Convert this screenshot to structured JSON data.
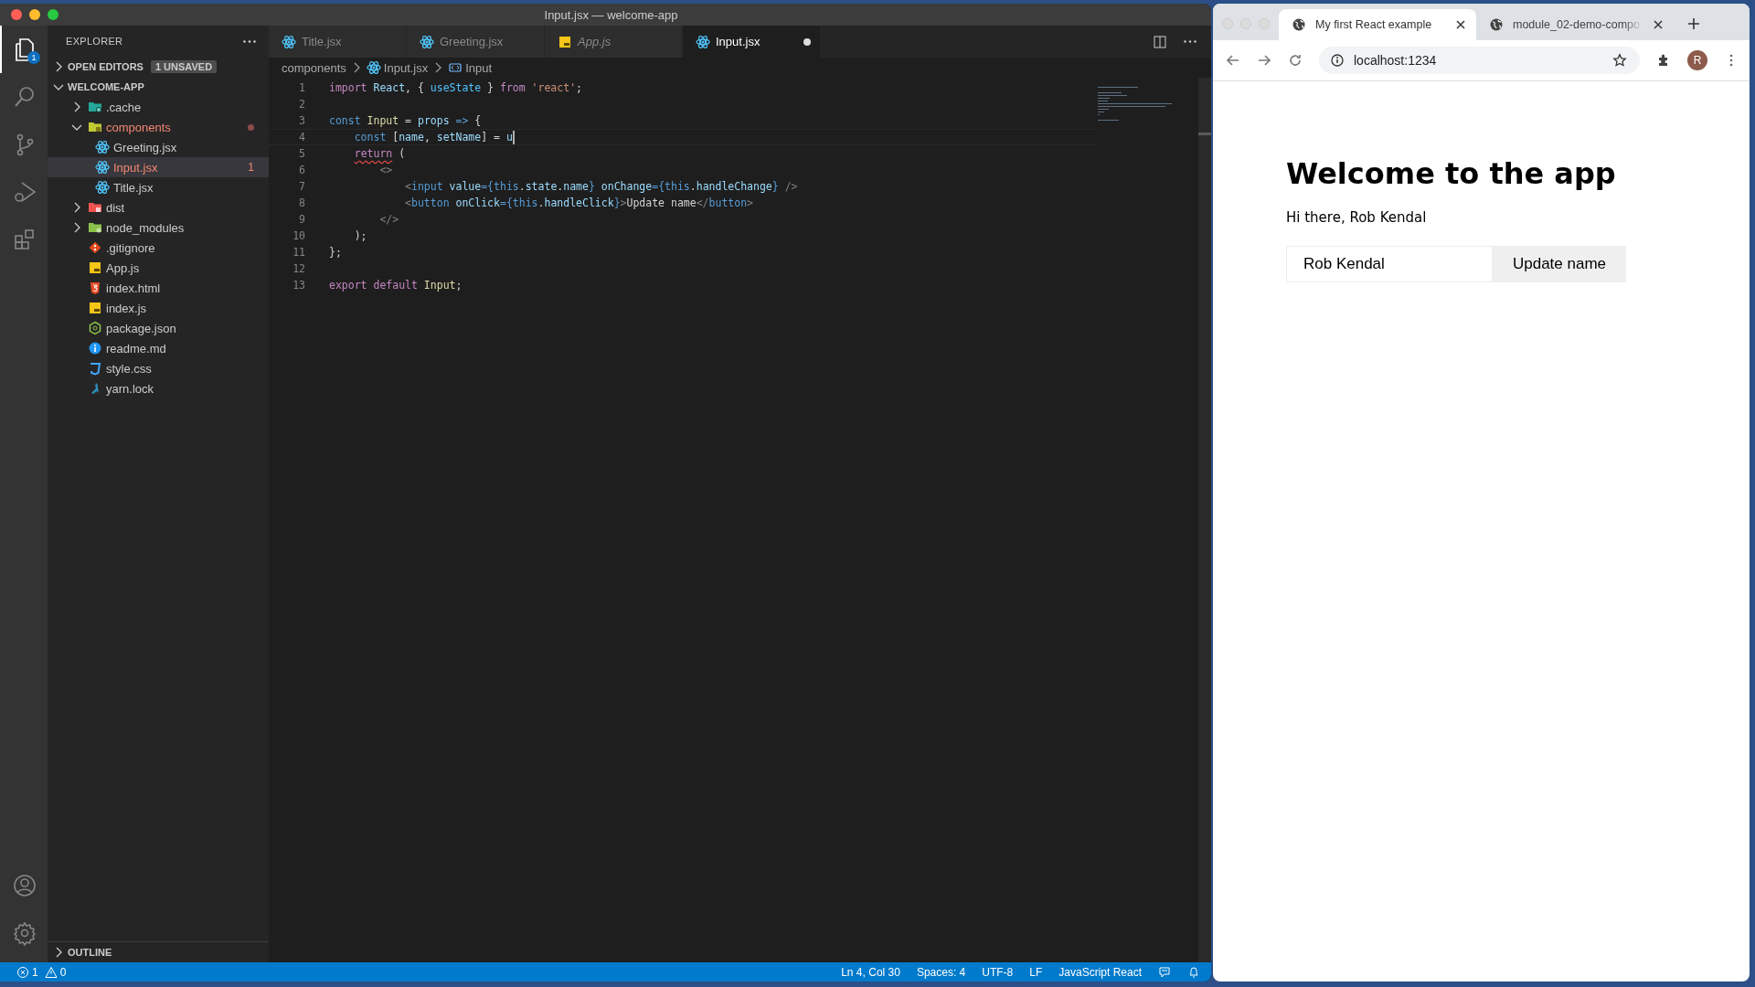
{
  "editor_window": {
    "title": "Input.jsx — welcome-app",
    "activity_bar": [
      {
        "kind": "files",
        "selected": true,
        "badge": "1"
      },
      {
        "kind": "search",
        "selected": false
      },
      {
        "kind": "source-control",
        "selected": false
      },
      {
        "kind": "run",
        "selected": false
      },
      {
        "kind": "extensions",
        "selected": false
      }
    ],
    "activity_bar_bottom": [
      {
        "kind": "account"
      },
      {
        "kind": "settings"
      }
    ],
    "sidebar": {
      "title": "EXPLORER",
      "open_editors": {
        "label": "OPEN EDITORS",
        "badge": "1 UNSAVED",
        "expanded": false
      },
      "project": {
        "label": "WELCOME-APP",
        "expanded": true
      },
      "tree": [
        {
          "label": ".cache",
          "kind": "cache-folder",
          "expanded": false,
          "selected": false,
          "error": false
        },
        {
          "label": "components",
          "kind": "components-folder",
          "expanded": true,
          "selected": false,
          "error": true,
          "children": [
            {
              "label": "Greeting.jsx",
              "kind": "react-file",
              "selected": false,
              "error": false
            },
            {
              "label": "Input.jsx",
              "kind": "react-file",
              "selected": true,
              "error": true,
              "problems": "1"
            },
            {
              "label": "Title.jsx",
              "kind": "react-file",
              "selected": false,
              "error": false
            }
          ]
        },
        {
          "label": "dist",
          "kind": "dist-folder",
          "expanded": false,
          "selected": false,
          "error": false
        },
        {
          "label": "node_modules",
          "kind": "node-folder",
          "expanded": false,
          "selected": false,
          "error": false
        },
        {
          "label": ".gitignore",
          "kind": "git-file",
          "selected": false,
          "error": false
        },
        {
          "label": "App.js",
          "kind": "js-file",
          "selected": false,
          "error": false
        },
        {
          "label": "index.html",
          "kind": "html-file",
          "selected": false,
          "error": false
        },
        {
          "label": "index.js",
          "kind": "js-file",
          "selected": false,
          "error": false
        },
        {
          "label": "package.json",
          "kind": "json-file",
          "selected": false,
          "error": false
        },
        {
          "label": "readme.md",
          "kind": "md-file",
          "selected": false,
          "error": false
        },
        {
          "label": "style.css",
          "kind": "css-file",
          "selected": false,
          "error": false
        },
        {
          "label": "yarn.lock",
          "kind": "yarn-file",
          "selected": false,
          "error": false
        }
      ],
      "outline": {
        "label": "OUTLINE",
        "expanded": false
      }
    },
    "tabs": [
      {
        "label": "Title.jsx",
        "kind": "react-file",
        "selected": false,
        "preview": false,
        "dirty": false
      },
      {
        "label": "Greeting.jsx",
        "kind": "react-file",
        "selected": false,
        "preview": false,
        "dirty": false
      },
      {
        "label": "App.js",
        "kind": "js-file",
        "selected": false,
        "preview": true,
        "dirty": false
      },
      {
        "label": "Input.jsx",
        "kind": "react-file",
        "selected": true,
        "preview": false,
        "dirty": true
      }
    ],
    "breadcrumb": [
      {
        "label": "components",
        "kind": "folder"
      },
      {
        "label": "Input.jsx",
        "kind": "react-file"
      },
      {
        "label": "Input",
        "kind": "symbol"
      }
    ],
    "code": [
      {
        "number": "1",
        "cursor": false,
        "tokens": [
          {
            "text": "import ",
            "kind": "kw"
          },
          {
            "text": "React",
            "kind": "var"
          },
          {
            "text": ", { ",
            "kind": "p"
          },
          {
            "text": "useState",
            "kind": "fn"
          },
          {
            "text": " } ",
            "kind": "p"
          },
          {
            "text": "from ",
            "kind": "kw"
          },
          {
            "text": "'react'",
            "kind": "str"
          },
          {
            "text": ";",
            "kind": "p"
          }
        ]
      },
      {
        "number": "2",
        "cursor": false
      },
      {
        "number": "3",
        "cursor": false,
        "tokens": [
          {
            "text": "const ",
            "kind": "st"
          },
          {
            "text": "Input",
            "kind": "cls"
          },
          {
            "text": " = ",
            "kind": "p"
          },
          {
            "text": "props",
            "kind": "var"
          },
          {
            "text": " => ",
            "kind": "st"
          },
          {
            "text": "{",
            "kind": "p"
          }
        ]
      },
      {
        "number": "4",
        "cursor": true,
        "tokens": [
          {
            "text": "    const ",
            "kind": "st"
          },
          {
            "text": "[",
            "kind": "p"
          },
          {
            "text": "name",
            "kind": "var"
          },
          {
            "text": ", ",
            "kind": "p"
          },
          {
            "text": "setName",
            "kind": "var"
          },
          {
            "text": "] = ",
            "kind": "p"
          },
          {
            "text": "u",
            "kind": "var"
          }
        ]
      },
      {
        "number": "5",
        "cursor": false,
        "tokens": [
          {
            "text": "    return",
            "kind": "flagged"
          },
          {
            "text": " (",
            "kind": "p"
          }
        ]
      },
      {
        "number": "6",
        "cursor": false,
        "tokens": [
          {
            "text": "        <>",
            "kind": "tag"
          }
        ]
      },
      {
        "number": "7",
        "cursor": false,
        "tokens": [
          {
            "text": "            <",
            "kind": "tag"
          },
          {
            "text": "input ",
            "kind": "st"
          },
          {
            "text": "value",
            "kind": "var"
          },
          {
            "text": "={",
            "kind": "st"
          },
          {
            "text": "this",
            "kind": "st"
          },
          {
            "text": ".",
            "kind": "p"
          },
          {
            "text": "state",
            "kind": "var"
          },
          {
            "text": ".",
            "kind": "p"
          },
          {
            "text": "name",
            "kind": "var"
          },
          {
            "text": "}",
            "kind": "st"
          },
          {
            "text": " onChange",
            "kind": "var"
          },
          {
            "text": "={",
            "kind": "st"
          },
          {
            "text": "this",
            "kind": "st"
          },
          {
            "text": ".",
            "kind": "p"
          },
          {
            "text": "handleChange",
            "kind": "var"
          },
          {
            "text": "}",
            "kind": "st"
          },
          {
            "text": " />",
            "kind": "tag"
          }
        ]
      },
      {
        "number": "8",
        "cursor": false,
        "tokens": [
          {
            "text": "            <",
            "kind": "tag"
          },
          {
            "text": "button ",
            "kind": "st"
          },
          {
            "text": "onClick",
            "kind": "var"
          },
          {
            "text": "={",
            "kind": "st"
          },
          {
            "text": "this",
            "kind": "st"
          },
          {
            "text": ".",
            "kind": "p"
          },
          {
            "text": "handleClick",
            "kind": "var"
          },
          {
            "text": "}",
            "kind": "st"
          },
          {
            "text": ">",
            "kind": "tag"
          },
          {
            "text": "Update name",
            "kind": "p"
          },
          {
            "text": "</",
            "kind": "tag"
          },
          {
            "text": "button",
            "kind": "st"
          },
          {
            "text": ">",
            "kind": "tag"
          }
        ]
      },
      {
        "number": "9",
        "cursor": false,
        "tokens": [
          {
            "text": "        </>",
            "kind": "tag"
          }
        ]
      },
      {
        "number": "10",
        "cursor": false,
        "tokens": [
          {
            "text": "    );",
            "kind": "p"
          }
        ]
      },
      {
        "number": "11",
        "cursor": false,
        "tokens": [
          {
            "text": "};",
            "kind": "p"
          }
        ]
      },
      {
        "number": "12",
        "cursor": false
      },
      {
        "number": "13",
        "cursor": false,
        "tokens": [
          {
            "text": "export default ",
            "kind": "kw"
          },
          {
            "text": "Input",
            "kind": "cls"
          },
          {
            "text": ";",
            "kind": "p"
          }
        ]
      }
    ],
    "status_bar": {
      "errors": "1",
      "warnings": "0",
      "items": [
        "Ln 4, Col 30",
        "Spaces: 4",
        "UTF-8",
        "LF",
        "JavaScript React"
      ]
    }
  },
  "browser_window": {
    "tabs": [
      {
        "title": "My first React example",
        "selected": true
      },
      {
        "title": "module_02-demo-compo",
        "selected": false
      }
    ],
    "address": "localhost:1234",
    "profile": "R",
    "page": {
      "heading": "Welcome to the app",
      "greeting": "Hi there, Rob Kendal",
      "name_input": {
        "value": "Rob Kendal"
      },
      "button": "Update name"
    }
  }
}
